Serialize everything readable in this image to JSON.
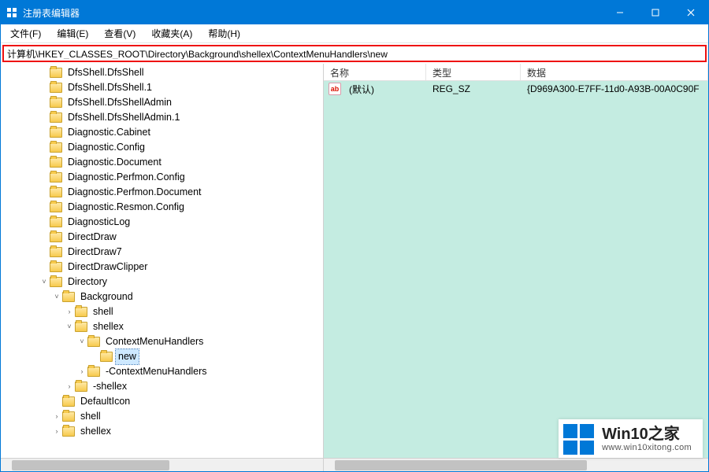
{
  "window": {
    "title": "注册表编辑器"
  },
  "menu": {
    "file": "文件(F)",
    "edit": "编辑(E)",
    "view": "查看(V)",
    "favorites": "收藏夹(A)",
    "help": "帮助(H)"
  },
  "address": {
    "value": "计算机\\HKEY_CLASSES_ROOT\\Directory\\Background\\shellex\\ContextMenuHandlers\\new"
  },
  "tree": {
    "selected": "new",
    "nodes": [
      {
        "depth": 3,
        "tw": "",
        "label": "DfsShell.DfsShell"
      },
      {
        "depth": 3,
        "tw": "",
        "label": "DfsShell.DfsShell.1"
      },
      {
        "depth": 3,
        "tw": "",
        "label": "DfsShell.DfsShellAdmin"
      },
      {
        "depth": 3,
        "tw": "",
        "label": "DfsShell.DfsShellAdmin.1"
      },
      {
        "depth": 3,
        "tw": "",
        "label": "Diagnostic.Cabinet"
      },
      {
        "depth": 3,
        "tw": "",
        "label": "Diagnostic.Config"
      },
      {
        "depth": 3,
        "tw": "",
        "label": "Diagnostic.Document"
      },
      {
        "depth": 3,
        "tw": "",
        "label": "Diagnostic.Perfmon.Config"
      },
      {
        "depth": 3,
        "tw": "",
        "label": "Diagnostic.Perfmon.Document"
      },
      {
        "depth": 3,
        "tw": "",
        "label": "Diagnostic.Resmon.Config"
      },
      {
        "depth": 3,
        "tw": "",
        "label": "DiagnosticLog"
      },
      {
        "depth": 3,
        "tw": "",
        "label": "DirectDraw"
      },
      {
        "depth": 3,
        "tw": "",
        "label": "DirectDraw7"
      },
      {
        "depth": 3,
        "tw": "",
        "label": "DirectDrawClipper"
      },
      {
        "depth": 3,
        "tw": "v",
        "label": "Directory"
      },
      {
        "depth": 4,
        "tw": "v",
        "label": "Background"
      },
      {
        "depth": 5,
        "tw": ">",
        "label": "shell"
      },
      {
        "depth": 5,
        "tw": "v",
        "label": "shellex"
      },
      {
        "depth": 6,
        "tw": "v",
        "label": "ContextMenuHandlers"
      },
      {
        "depth": 7,
        "tw": "",
        "label": "new",
        "selected": true
      },
      {
        "depth": 6,
        "tw": ">",
        "label": "-ContextMenuHandlers"
      },
      {
        "depth": 5,
        "tw": ">",
        "label": "-shellex"
      },
      {
        "depth": 4,
        "tw": "",
        "label": "DefaultIcon"
      },
      {
        "depth": 4,
        "tw": ">",
        "label": "shell"
      },
      {
        "depth": 4,
        "tw": ">",
        "label": "shellex"
      }
    ]
  },
  "list": {
    "columns": {
      "name": "名称",
      "type": "类型",
      "data": "数据"
    },
    "rows": [
      {
        "icon": "ab",
        "name": "(默认)",
        "type": "REG_SZ",
        "data": "{D969A300-E7FF-11d0-A93B-00A0C90F"
      }
    ]
  },
  "watermark": {
    "big": "Win10之家",
    "small": "www.win10xitong.com"
  }
}
